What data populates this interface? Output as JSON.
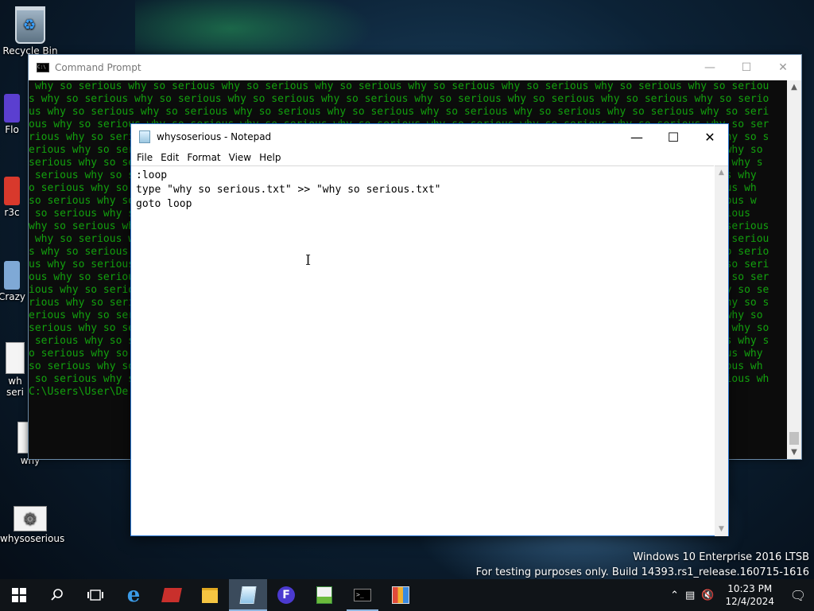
{
  "desktop": {
    "icons": [
      {
        "label": "Recycle Bin"
      },
      {
        "label": "Flo"
      },
      {
        "label": "r3c"
      },
      {
        "label": "Crazy"
      },
      {
        "label": "wh"
      },
      {
        "label": "seri"
      },
      {
        "label": "why"
      },
      {
        "label": "whysoserious"
      }
    ]
  },
  "cmd": {
    "title": "Command Prompt",
    "lines": [
      " why so serious why so serious why so serious why so serious why so serious why so serious why so serious why so seriou",
      "s why so serious why so serious why so serious why so serious why so serious why so serious why so serious why so serio",
      "us why so serious why so serious why so serious why so serious why so serious why so serious why so serious why so seri",
      "ous why so serious why so serious why so serious why so serious why so serious why so serious why so serious why so ser",
      "rious why so serious why so serious why so serious why so serious why so serious why so serious why so serious why so s",
      "erious why so serious why so serious why so serious why so serious why so serious why so serious why so serious why so ",
      "serious why so serious why so serious why so serious why so serious why so serious why so serious why so serious why s",
      " serious why so serious why so serious why so serious why so serious why so serious why so serious why so serious why",
      "o serious why so serious why so serious why so serious why so serious why so serious why so serious why so serious wh",
      "so serious why so serious why so serious why so serious why so serious why so serious why so serious why so serious w",
      " so serious why so serious why so serious why so serious why so serious why so serious why so serious why so serious ",
      "why so serious why so serious why so serious why so serious why so serious why so serious why so serious why so serious",
      " why so serious why so serious why so serious why so serious why so serious why so serious why so serious why so seriou",
      "s why so serious why so serious why so serious why so serious why so serious why so serious why so serious why so serio",
      "us why so serious why so serious why so serious why so serious why so serious why so serious why so serious why so seri",
      "ous why so serious why so serious why so serious why so serious why so serious why so serious why so serious why so ser",
      "ious why so serious why so serious why so serious why so serious why so serious why so serious why so serious why so se",
      "rious why so serious why so serious why so serious why so serious why so serious why so serious why so serious why so s",
      "erious why so serious why so serious why so serious why so serious why so serious why so serious why so serious why so ",
      "serious why so serious why so serious why so serious why so serious why so serious why so serious why so serious why so",
      " serious why so serious why so serious why so serious why so serious why so serious why so serious why so serious why s",
      "o serious why so serious why so serious why so serious why so serious why so serious why so serious why so serious why",
      "so serious why so serious why so serious why so serious why so serious why so serious why so serious why so serious wh",
      " so serious why so serious why so serious why so serious why so serious why so serious why so serious why so serious wh",
      "C:\\Users\\User\\De"
    ]
  },
  "notepad": {
    "title": "whysoserious - Notepad",
    "menu": [
      "File",
      "Edit",
      "Format",
      "View",
      "Help"
    ],
    "content": ":loop\ntype \"why so serious.txt\" >> \"why so serious.txt\"\ngoto loop"
  },
  "watermark": {
    "line1": "Windows 10 Enterprise 2016 LTSB",
    "line2": "For testing purposes only. Build 14393.rs1_release.160715-1616"
  },
  "taskbar": {
    "apps": [
      "start-button",
      "search",
      "task-view",
      "edge",
      "app-red",
      "file-explorer",
      "notepad",
      "app-f",
      "app-chart",
      "command-prompt",
      "app-ui"
    ],
    "clock": {
      "time": "10:23 PM",
      "date": "12/4/2024"
    }
  }
}
